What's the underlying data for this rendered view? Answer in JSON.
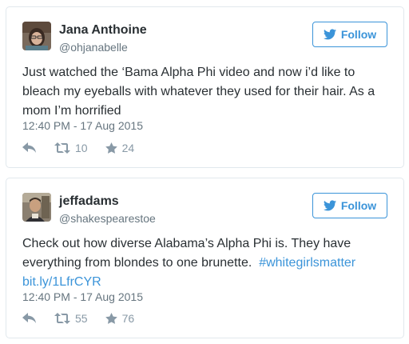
{
  "tweets": [
    {
      "name": "Jana Anthoine",
      "handle": "@ohjanabelle",
      "follow_label": "Follow",
      "text": "Just watched the ‘Bama Alpha Phi video and now i’d like to bleach my eyeballs with whatever they used for their hair. As a mom I’m horrified",
      "timestamp": "12:40 PM - 17 Aug 2015",
      "retweets": "10",
      "favorites": "24"
    },
    {
      "name": "jeffadams",
      "handle": "@shakespearestoe",
      "follow_label": "Follow",
      "text": "Check out how diverse Alabama’s Alpha Phi is.  They have everything from blondes to one brunette.",
      "hashtag": "#whitegirlsmatter",
      "link": "bit.ly/1LfrCYR",
      "timestamp": "12:40 PM - 17 Aug 2015",
      "retweets": "55",
      "favorites": "76"
    }
  ],
  "colors": {
    "accent": "#3b94d9",
    "text": "#292f33",
    "muted": "#66757f",
    "icon": "#8899a6",
    "border": "#e1e8ed"
  },
  "icons": [
    "bird-icon",
    "reply-icon",
    "retweet-icon",
    "star-icon"
  ]
}
